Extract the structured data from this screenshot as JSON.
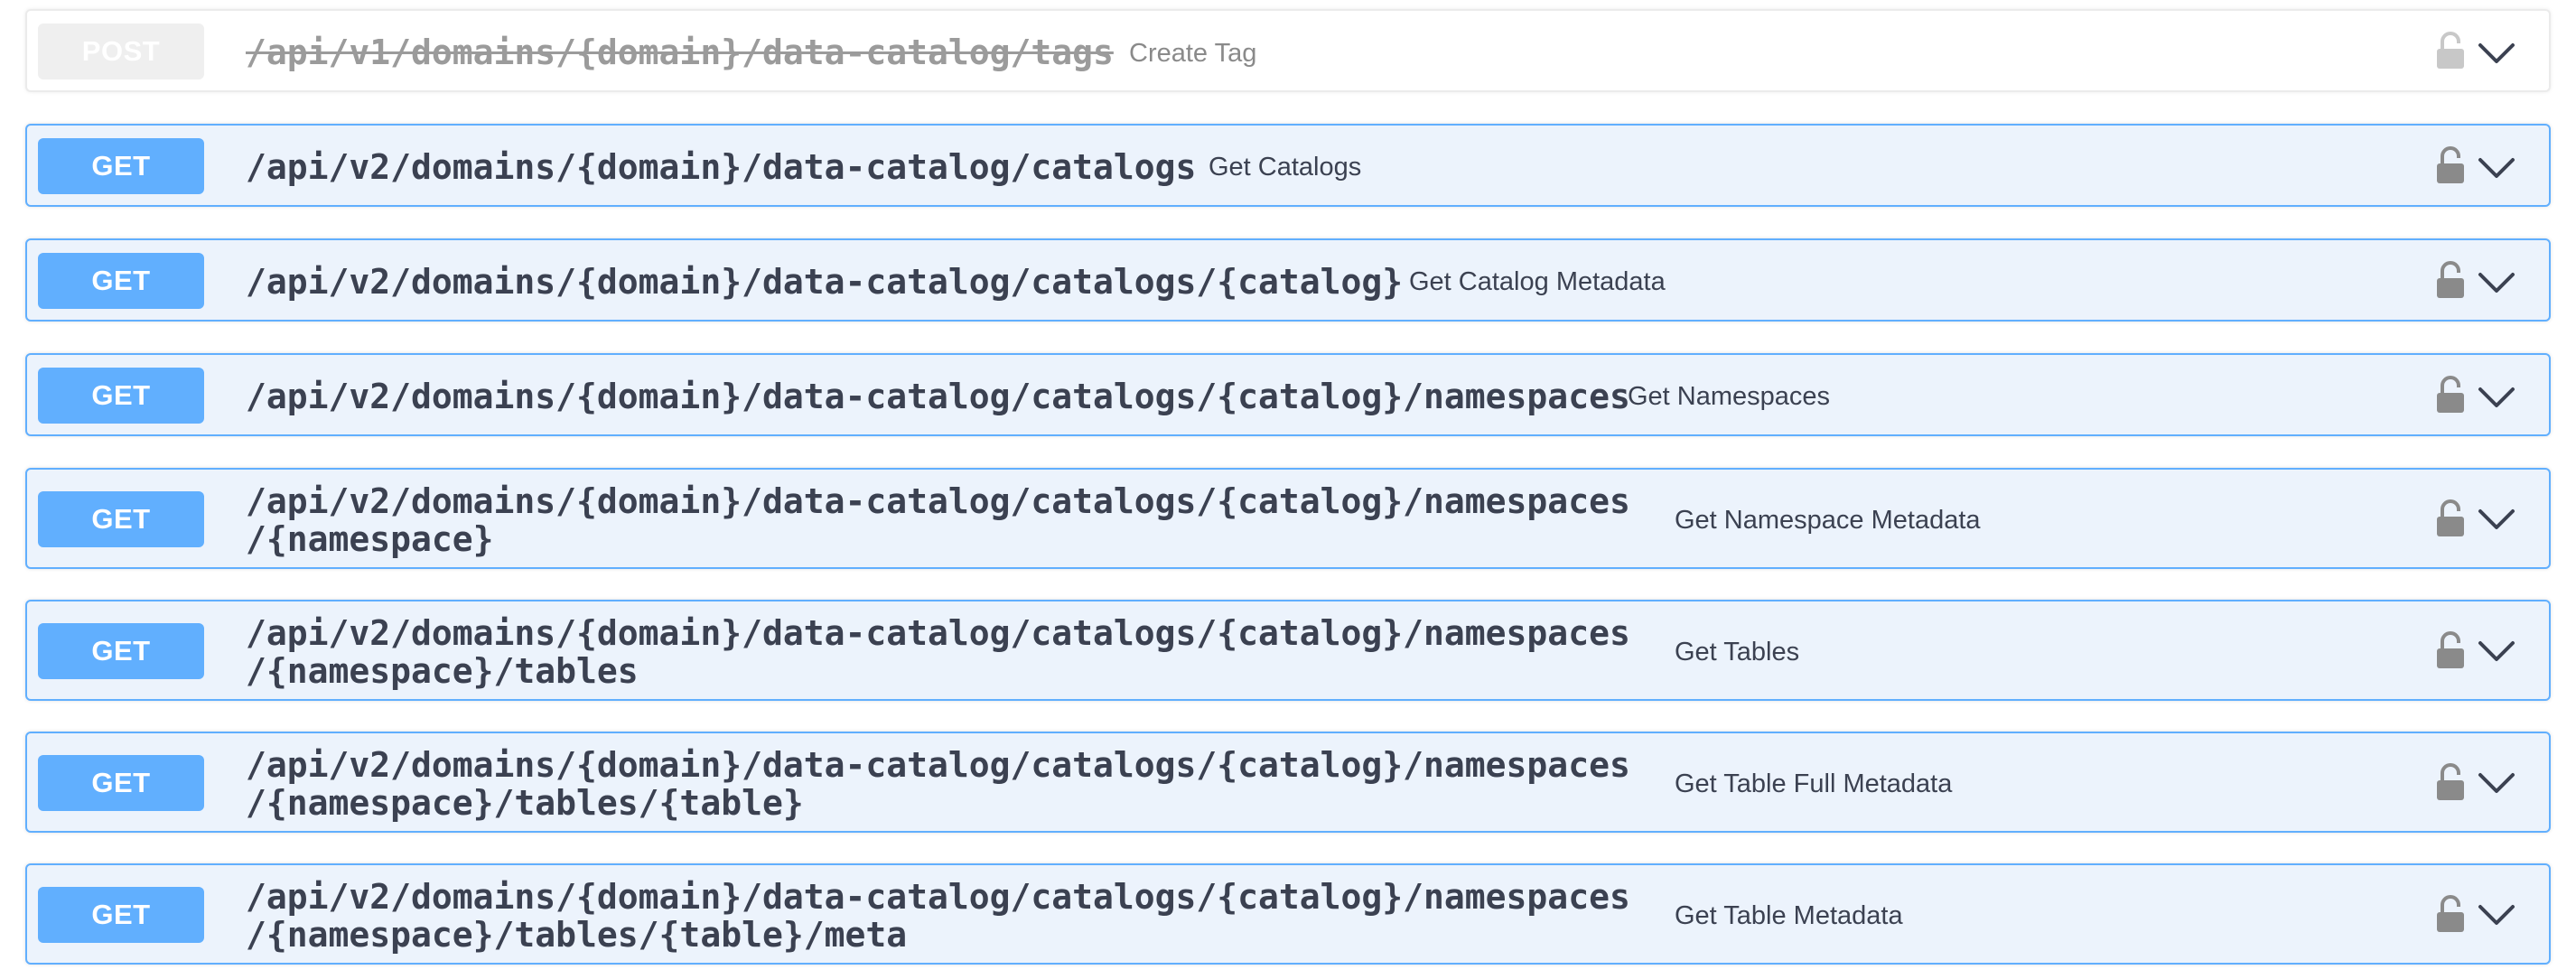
{
  "operations": [
    {
      "method": "POST",
      "path": "/api/v1/domains/{domain}/data-catalog/tags",
      "summary": "Create Tag",
      "deprecated": true
    },
    {
      "method": "GET",
      "path": "/api/v2/domains/{domain}/data-catalog/catalogs",
      "summary": "Get Catalogs"
    },
    {
      "method": "GET",
      "path": "/api/v2/domains/{domain}/data-catalog/catalogs/{catalog}",
      "summary": "Get Catalog Metadata"
    },
    {
      "method": "GET",
      "path": "/api/v2/domains/{domain}/data-catalog/catalogs/{catalog}/namespaces",
      "summary": "Get Namespaces"
    },
    {
      "method": "GET",
      "path_line1": "/api/v2/domains/{domain}/data-catalog/catalogs/{catalog}/namespaces",
      "path_line2": "/{namespace}",
      "summary": "Get Namespace Metadata"
    },
    {
      "method": "GET",
      "path_line1": "/api/v2/domains/{domain}/data-catalog/catalogs/{catalog}/namespaces",
      "path_line2": "/{namespace}/tables",
      "summary": "Get Tables"
    },
    {
      "method": "GET",
      "path_line1": "/api/v2/domains/{domain}/data-catalog/catalogs/{catalog}/namespaces",
      "path_line2": "/{namespace}/tables/{table}",
      "summary": "Get Table Full Metadata"
    },
    {
      "method": "GET",
      "path_line1": "/api/v2/domains/{domain}/data-catalog/catalogs/{catalog}/namespaces",
      "path_line2": "/{namespace}/tables/{table}/meta",
      "summary": "Get Table Metadata"
    }
  ],
  "colors": {
    "get": "#61affe",
    "get_bg": "#ecf3fc",
    "deprecated": "#ebebeb",
    "text": "#3b4151",
    "icon": "#8a8a8a"
  },
  "icons": {
    "lock": "lock-icon",
    "expand": "chevron-down-icon"
  }
}
